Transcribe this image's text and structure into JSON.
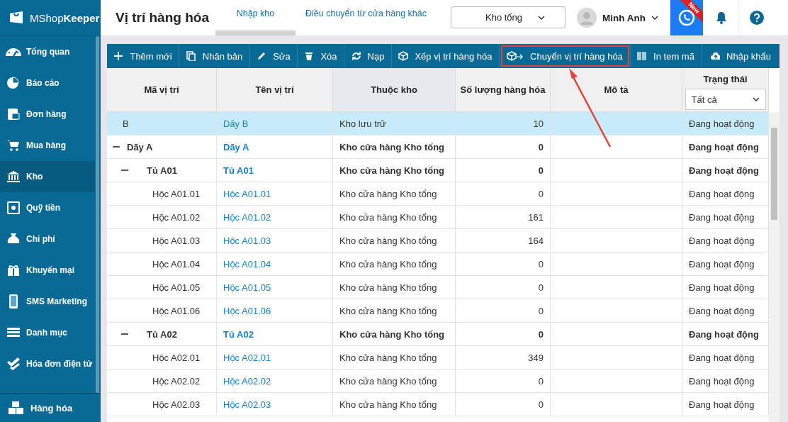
{
  "sidebar": {
    "logo": "MShop**Keeper**",
    "items": [
      {
        "label": "Tổng quan",
        "selected": false
      },
      {
        "label": "Báo cáo",
        "selected": false
      },
      {
        "label": "Đơn hàng",
        "selected": false
      },
      {
        "label": "Mua hàng",
        "selected": false
      },
      {
        "label": "Kho",
        "selected": true
      },
      {
        "label": "Quỹ tiền",
        "selected": false
      },
      {
        "label": "Chi phí",
        "selected": false
      },
      {
        "label": "Khuyến mại",
        "selected": false
      },
      {
        "label": "SMS Marketing",
        "selected": false
      },
      {
        "label": "Danh mục",
        "selected": false
      },
      {
        "label": "Hóa đơn điện tử",
        "selected": false
      }
    ],
    "footer_item": {
      "label": "Hàng hóa"
    }
  },
  "header": {
    "title": "Vị trí hàng hóa",
    "tabs": [
      {
        "label": "Nhập kho",
        "selected": true
      },
      {
        "label": "Điều chuyển từ cửa hàng khác",
        "selected": false
      }
    ],
    "store_select": {
      "value": "Kho tổng"
    },
    "user": {
      "name": "Minh Anh"
    },
    "badge": "New"
  },
  "toolbar": [
    {
      "label": "Thêm mới",
      "highlighted": false
    },
    {
      "label": "Nhân bản",
      "highlighted": false
    },
    {
      "label": "Sửa",
      "highlighted": false
    },
    {
      "label": "Xóa",
      "highlighted": false
    },
    {
      "label": "Nạp",
      "highlighted": false
    },
    {
      "label": "Xếp vị trí hàng hóa",
      "highlighted": false
    },
    {
      "label": "Chuyển vị trí hàng hóa",
      "highlighted": true
    },
    {
      "label": "In tem mã",
      "highlighted": false
    },
    {
      "label": "Nhập khẩu",
      "highlighted": false
    }
  ],
  "table": {
    "columns": [
      "Mã vị trí",
      "Tên vị trí",
      "Thuộc kho",
      "Số lượng hàng hóa",
      "Mô tả",
      "Trạng thái"
    ],
    "status_filter": {
      "value": "Tất cả"
    },
    "rows": [
      {
        "code": "B",
        "name": "Dãy B",
        "warehouse": "Kho lưu trữ",
        "quantity": "10",
        "status": "Đang hoạt động",
        "selected": true
      },
      {
        "code": "Dãy A",
        "name": "Dãy A",
        "warehouse": "Kho cửa hàng Kho tổng",
        "quantity": "0",
        "status": "Đang hoạt động",
        "selected": false,
        "expanded": true,
        "children": [
          {
            "code": "Tủ A01",
            "name": "Tủ A01",
            "warehouse": "Kho cửa hàng Kho tổng",
            "quantity": "0",
            "status": "Đang hoạt động",
            "selected": false,
            "expanded": true,
            "children": [
              {
                "code": "Hộc A01.01",
                "name": "Hộc A01.01",
                "warehouse": "Kho cửa hàng Kho tổng",
                "quantity": "0",
                "status": "Đang hoạt động",
                "selected": false
              },
              {
                "code": "Hộc A01.02",
                "name": "Hộc A01.02",
                "warehouse": "Kho cửa hàng Kho tổng",
                "quantity": "161",
                "status": "Đang hoạt động",
                "selected": false
              },
              {
                "code": "Hộc A01.03",
                "name": "Hộc A01.03",
                "warehouse": "Kho cửa hàng Kho tổng",
                "quantity": "164",
                "status": "Đang hoạt động",
                "selected": false
              },
              {
                "code": "Hộc A01.04",
                "name": "Hộc A01.04",
                "warehouse": "Kho cửa hàng Kho tổng",
                "quantity": "0",
                "status": "Đang hoạt động",
                "selected": false
              },
              {
                "code": "Hộc A01.05",
                "name": "Hộc A01.05",
                "warehouse": "Kho cửa hàng Kho tổng",
                "quantity": "0",
                "status": "Đang hoạt động",
                "selected": false
              },
              {
                "code": "Hộc A01.06",
                "name": "Hộc A01.06",
                "warehouse": "Kho cửa hàng Kho tổng",
                "quantity": "0",
                "status": "Đang hoạt động",
                "selected": false
              }
            ]
          },
          {
            "code": "Tủ A02",
            "name": "Tủ A02",
            "warehouse": "Kho cửa hàng Kho tổng",
            "quantity": "0",
            "status": "Đang hoạt động",
            "selected": false,
            "expanded": true,
            "children": [
              {
                "code": "Hộc A02.01",
                "name": "Hộc A02.01",
                "warehouse": "Kho cửa hàng Kho tổng",
                "quantity": "349",
                "status": "Đang hoạt động",
                "selected": false
              },
              {
                "code": "Hộc A02.02",
                "name": "Hộc A02.02",
                "warehouse": "Kho cửa hàng Kho tổng",
                "quantity": "0",
                "status": "Đang hoạt động",
                "selected": false
              },
              {
                "code": "Hộc A02.03",
                "name": "Hộc A02.03",
                "warehouse": "Kho cửa hàng Kho tổng",
                "quantity": "0",
                "status": "Đang hoạt động",
                "selected": false
              }
            ]
          }
        ]
      }
    ]
  }
}
